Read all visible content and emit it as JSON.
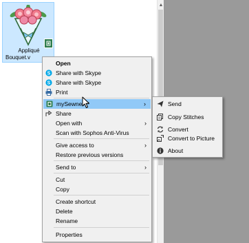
{
  "file": {
    "name_line1": "Appliqué",
    "name_line2": "Bouquet.v"
  },
  "context_menu": {
    "items": [
      {
        "label": "Open"
      },
      {
        "label": "Share with Skype"
      },
      {
        "label": "Share with Skype"
      },
      {
        "label": "Print"
      },
      {
        "label": "mySewnet™"
      },
      {
        "label": "Share"
      },
      {
        "label": "Open with"
      },
      {
        "label": "Scan with Sophos Anti-Virus"
      },
      {
        "label": "Give access to"
      },
      {
        "label": "Restore previous versions"
      },
      {
        "label": "Send to"
      },
      {
        "label": "Cut"
      },
      {
        "label": "Copy"
      },
      {
        "label": "Create shortcut"
      },
      {
        "label": "Delete"
      },
      {
        "label": "Rename"
      },
      {
        "label": "Properties"
      }
    ]
  },
  "submenu": {
    "items": [
      {
        "label": "Send"
      },
      {
        "label": "Copy Stitches"
      },
      {
        "label": "Convert"
      },
      {
        "label": "Convert to Picture"
      },
      {
        "label": "About"
      }
    ]
  },
  "colors": {
    "menu_bg": "#f0f0f0",
    "highlight": "#91c9f7",
    "selection": "#cce8ff",
    "skype_blue": "#00a8e8",
    "mysewnet_green": "#2e7d4f",
    "gray_pane": "#9a9a9a"
  }
}
